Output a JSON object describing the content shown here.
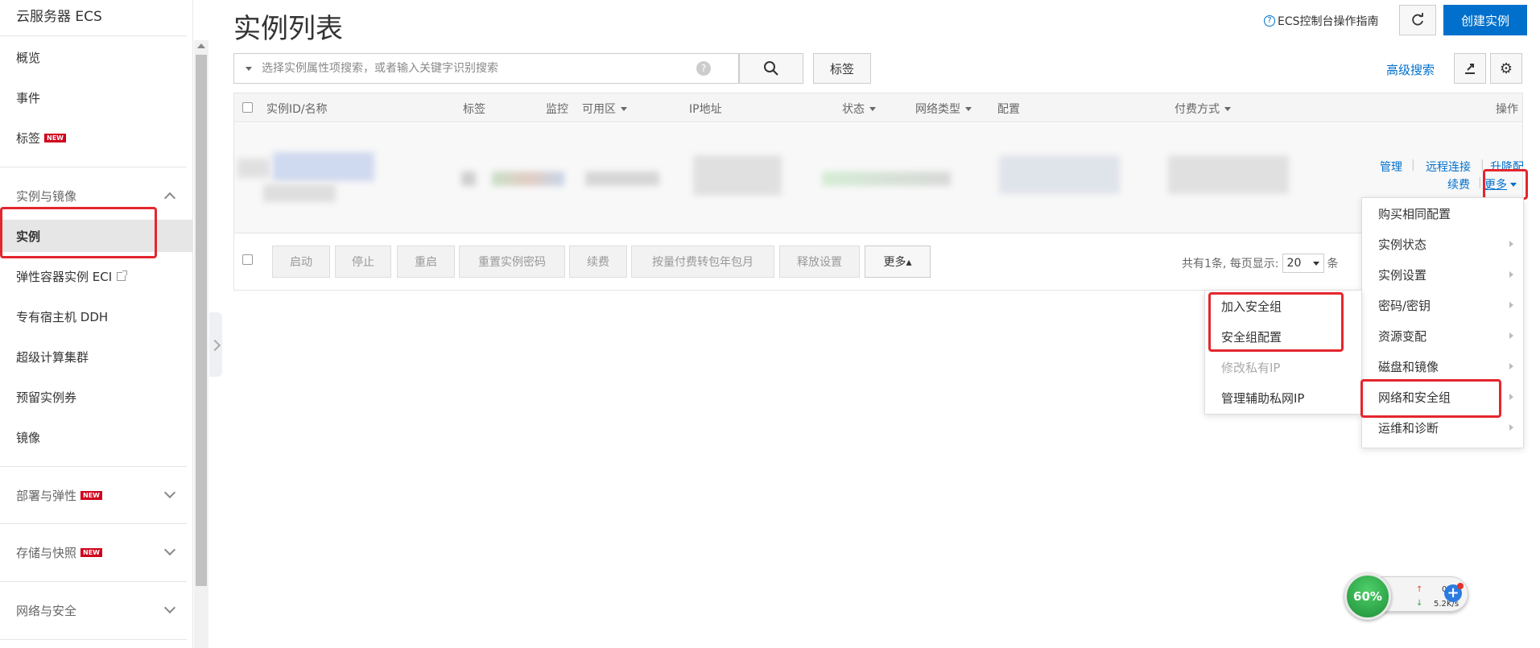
{
  "sidebar": {
    "title": "云服务器 ECS",
    "items": [
      {
        "label": "概览"
      },
      {
        "label": "事件"
      },
      {
        "label": "标签",
        "badge": "NEW"
      },
      {
        "label": "实例与镜像"
      },
      {
        "label": "实例"
      },
      {
        "label": "弹性容器实例 ECI"
      },
      {
        "label": "专有宿主机 DDH"
      },
      {
        "label": "超级计算集群"
      },
      {
        "label": "预留实例券"
      },
      {
        "label": "镜像"
      },
      {
        "label": "部署与弹性",
        "badge": "NEW"
      },
      {
        "label": "存储与快照",
        "badge": "NEW"
      },
      {
        "label": "网络与安全"
      }
    ]
  },
  "header": {
    "title": "实例列表",
    "help_link": "ECS控制台操作指南",
    "create_label": "创建实例"
  },
  "search": {
    "placeholder": "选择实例属性项搜索，或者输入关键字识别搜索",
    "tag_label": "标签",
    "advanced_label": "高级搜索"
  },
  "table": {
    "columns": {
      "id": "实例ID/名称",
      "tag": "标签",
      "monitor": "监控",
      "zone": "可用区",
      "ip": "IP地址",
      "status": "状态",
      "network": "网络类型",
      "config": "配置",
      "billing": "付费方式",
      "ops": "操作"
    },
    "row_ops": {
      "manage": "管理",
      "remote": "远程连接",
      "upgrade": "升降配",
      "renew": "续费",
      "more": "更多"
    }
  },
  "bulk": {
    "start": "启动",
    "stop": "停止",
    "restart": "重启",
    "reset_pwd": "重置实例密码",
    "renew": "续费",
    "convert": "按量付费转包年包月",
    "release": "释放设置",
    "more": "更多▴"
  },
  "pager": {
    "total_text": "共有1条, 每页显示:",
    "page_size": "20",
    "suffix": "条"
  },
  "more_menu": [
    {
      "label": "购买相同配置",
      "submenu": false
    },
    {
      "label": "实例状态",
      "submenu": true
    },
    {
      "label": "实例设置",
      "submenu": true
    },
    {
      "label": "密码/密钥",
      "submenu": true
    },
    {
      "label": "资源变配",
      "submenu": true
    },
    {
      "label": "磁盘和镜像",
      "submenu": true
    },
    {
      "label": "网络和安全组",
      "submenu": true
    },
    {
      "label": "运维和诊断",
      "submenu": true
    }
  ],
  "net_submenu": [
    {
      "label": "加入安全组",
      "disabled": false
    },
    {
      "label": "安全组配置",
      "disabled": false
    },
    {
      "label": "修改私有IP",
      "disabled": true
    },
    {
      "label": "管理辅助私网IP",
      "disabled": false
    }
  ],
  "net_widget": {
    "percent": "60%",
    "up": "0K/s",
    "down": "5.2K/s"
  },
  "colors": {
    "accent": "#0070cc",
    "highlight": "#e4262d",
    "badge": "#d0021b"
  }
}
